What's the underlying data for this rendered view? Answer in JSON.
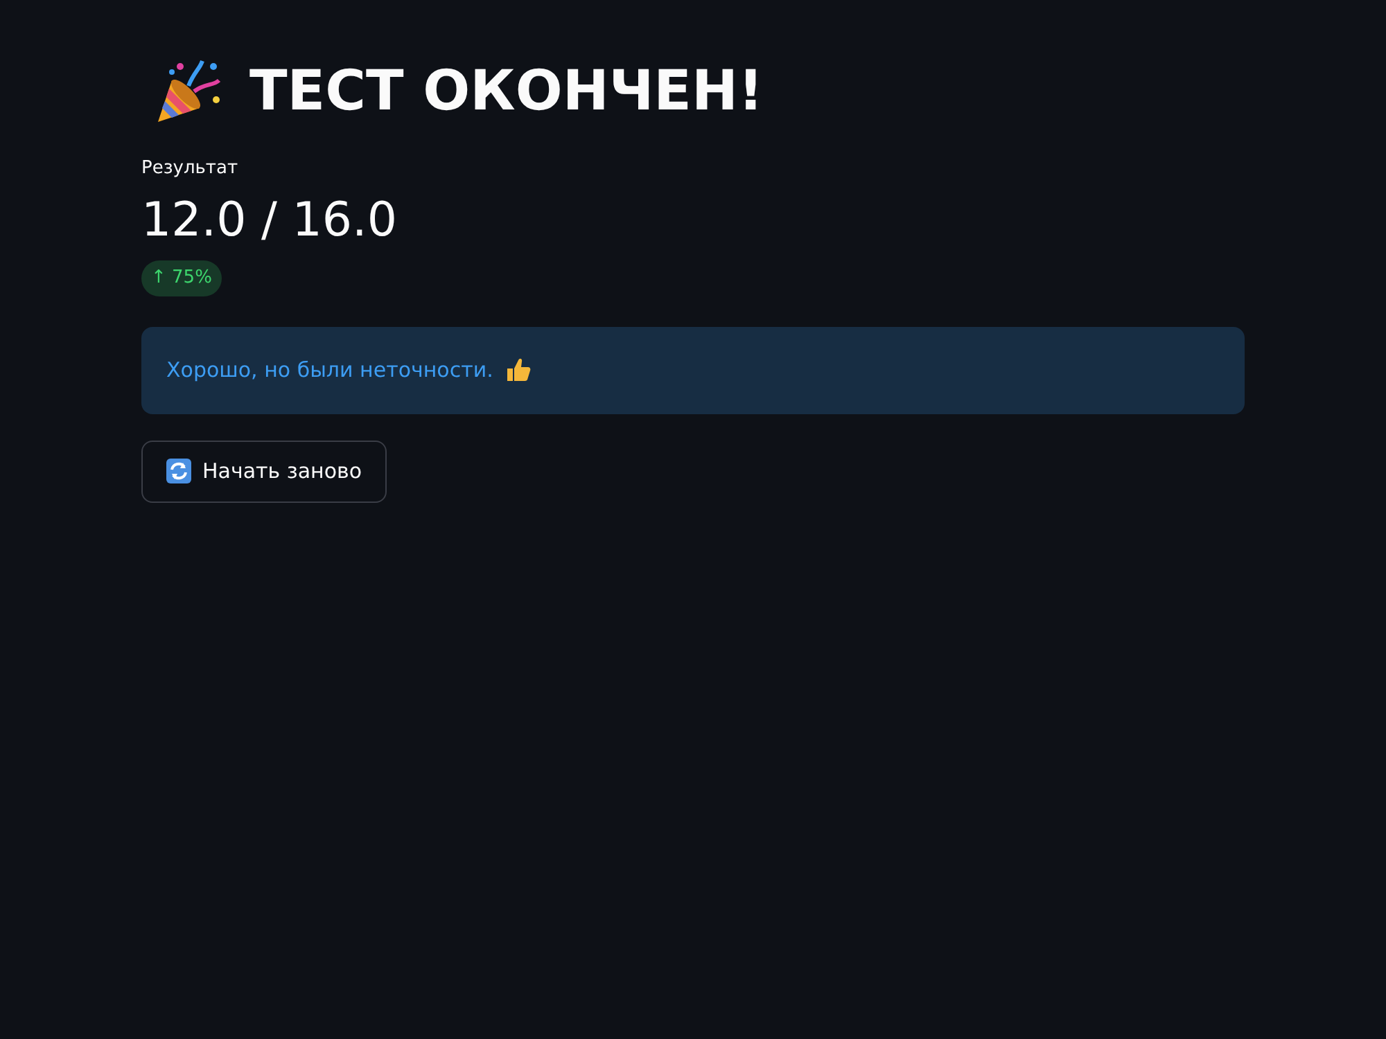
{
  "title": "ТЕСТ ОКОНЧЕН!",
  "metric": {
    "label": "Результат",
    "value": "12.0 / 16.0",
    "delta": "↑ 75%",
    "positive": true
  },
  "alert": {
    "kind": "info",
    "text": "Хорошо, но были неточности."
  },
  "restart_button": {
    "label": "Начать заново"
  }
}
